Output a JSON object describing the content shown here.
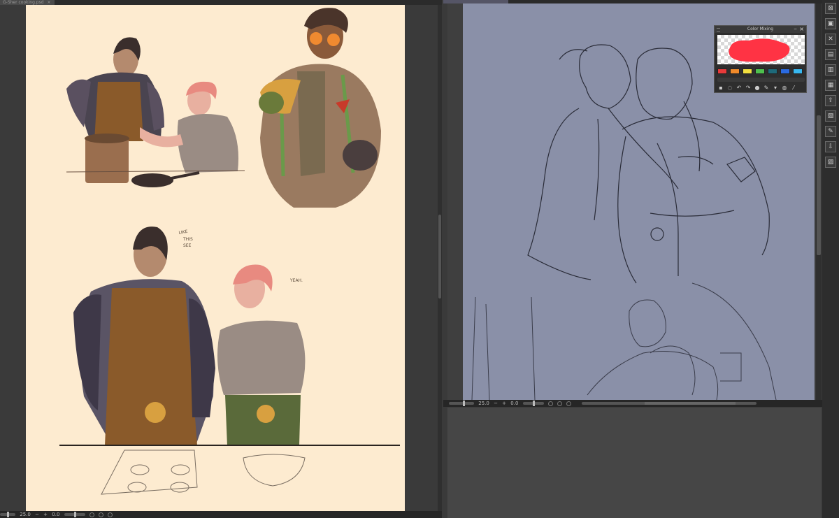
{
  "left_document": {
    "tab_title": "G-Sher cooking.psd",
    "tab_close": "×",
    "canvas_bg": "#fdebd0",
    "speech_like": [
      "LIKE",
      "THIS",
      "SEE"
    ],
    "speech_yeah": "YEAH.",
    "status": {
      "zoom": "25.0",
      "angle": "0.0"
    }
  },
  "right_document": {
    "tab_title": "",
    "canvas_bg": "#8a90a8",
    "status": {
      "zoom": "25.0",
      "angle": "0.0"
    }
  },
  "color_mixing": {
    "title": "Color Mixing",
    "minimize": "−",
    "close": "×",
    "paint_color": "#ff3344",
    "swatches": [
      "#e83a3a",
      "#f08a2a",
      "#f2e040",
      "#4ec04e",
      "#1e6a7a",
      "#2a6ae0",
      "#38b8f0"
    ],
    "tools": [
      "eraser-icon",
      "lasso-icon",
      "undo-icon",
      "redo-icon",
      "color-icon",
      "brush-icon",
      "fill-icon",
      "blend-icon",
      "eyedropper-icon"
    ]
  },
  "right_toolbar": {
    "buttons": [
      "close-doc-icon",
      "save-icon",
      "delete-icon",
      "page-icon",
      "layer-icon",
      "folder-icon",
      "export-icon",
      "properties-icon",
      "edit-icon",
      "import-icon",
      "archive-icon"
    ]
  }
}
